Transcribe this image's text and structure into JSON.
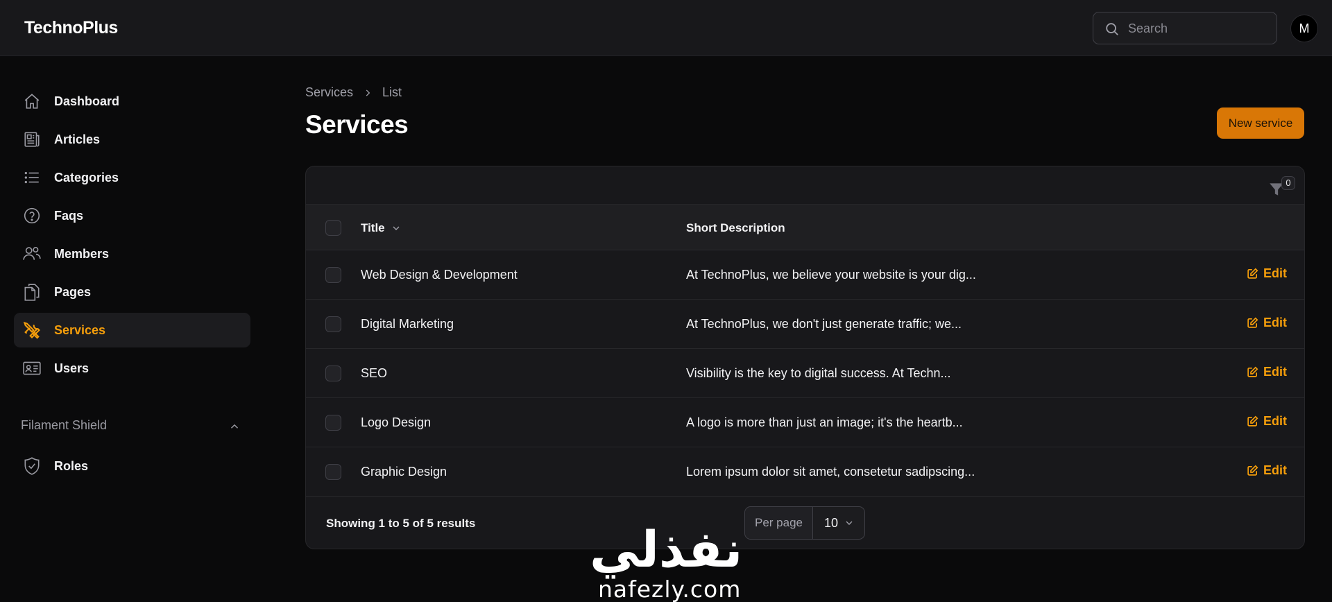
{
  "app": {
    "brand": "TechnoPlus",
    "search_placeholder": "Search",
    "user_initial": "M"
  },
  "colors": {
    "accent": "#f59e0b",
    "button": "#d97706",
    "background": "#0a0a0b",
    "panel": "#18181b"
  },
  "sidebar": {
    "items": [
      {
        "label": "Dashboard",
        "icon": "home-icon"
      },
      {
        "label": "Articles",
        "icon": "newspaper-icon"
      },
      {
        "label": "Categories",
        "icon": "list-icon"
      },
      {
        "label": "Faqs",
        "icon": "question-circle-icon"
      },
      {
        "label": "Members",
        "icon": "users-icon"
      },
      {
        "label": "Pages",
        "icon": "documents-icon"
      },
      {
        "label": "Services",
        "icon": "tools-icon",
        "active": true
      },
      {
        "label": "Users",
        "icon": "id-card-icon"
      }
    ],
    "group": {
      "label": "Filament Shield",
      "items": [
        {
          "label": "Roles",
          "icon": "shield-check-icon"
        }
      ]
    }
  },
  "header": {
    "breadcrumb": [
      "Services",
      "List"
    ],
    "title": "Services",
    "new_button": "New service"
  },
  "table": {
    "filter_count": "0",
    "columns": {
      "title": "Title",
      "description": "Short Description"
    },
    "rows": [
      {
        "title": "Web Design & Development",
        "description": "At TechnoPlus, we believe your website is your dig...",
        "action": "Edit"
      },
      {
        "title": "Digital Marketing",
        "description": "At TechnoPlus, we don't just generate traffic; we...",
        "action": "Edit"
      },
      {
        "title": "SEO",
        "description": "Visibility is the key to digital success. At Techn...",
        "action": "Edit"
      },
      {
        "title": "Logo Design",
        "description": "A logo is more than just an image; it's the heartb...",
        "action": "Edit"
      },
      {
        "title": "Graphic Design",
        "description": "Lorem ipsum dolor sit amet, consetetur sadipscing...",
        "action": "Edit"
      }
    ],
    "footer": {
      "summary": "Showing 1 to 5 of 5 results",
      "per_page_label": "Per page",
      "per_page_value": "10"
    }
  },
  "watermark": {
    "arabic": "نفذلي",
    "latin": "nafezly.com"
  }
}
